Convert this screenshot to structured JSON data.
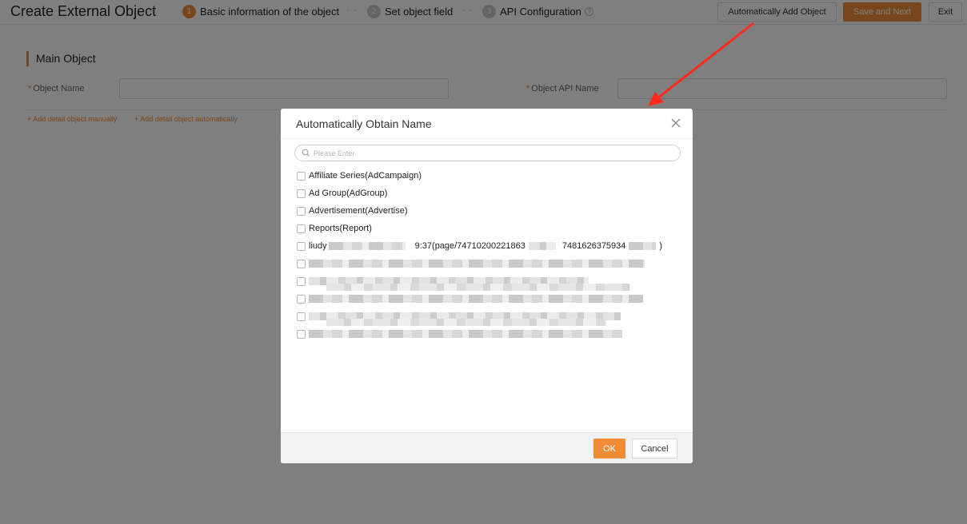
{
  "header": {
    "title": "Create External Object",
    "steps": [
      {
        "num": "1",
        "label": "Basic information of the object"
      },
      {
        "num": "2",
        "label": "Set object field"
      },
      {
        "num": "3",
        "label": "API Configuration"
      }
    ],
    "step_separator": "· ·",
    "buttons": {
      "auto_add": "Automatically Add Object",
      "save_next": "Save and Next",
      "exit": "Exit"
    }
  },
  "form": {
    "section_title": "Main Object",
    "object_name_label": "Object Name",
    "object_api_name_label": "Object API Name",
    "required_mark": "*",
    "links": {
      "manual": "+ Add detail object manually",
      "automatic": "+ Add detail object automatically"
    }
  },
  "modal": {
    "title": "Automatically Obtain Name",
    "search_placeholder": "Please Enter",
    "options": [
      "Affiliate Series(AdCampaign)",
      "Ad Group(AdGroup)",
      "Advertisement(Advertise)",
      "Reports(Report)"
    ],
    "partial_option": {
      "prefix": "liudy",
      "mid": "9:37(page/74710200221863",
      "mid2": "7481626375934",
      "suffix": ")"
    },
    "ok_label": "OK",
    "cancel_label": "Cancel"
  },
  "colors": {
    "accent": "#f08c38",
    "annotation_arrow": "#ff2a1a"
  }
}
